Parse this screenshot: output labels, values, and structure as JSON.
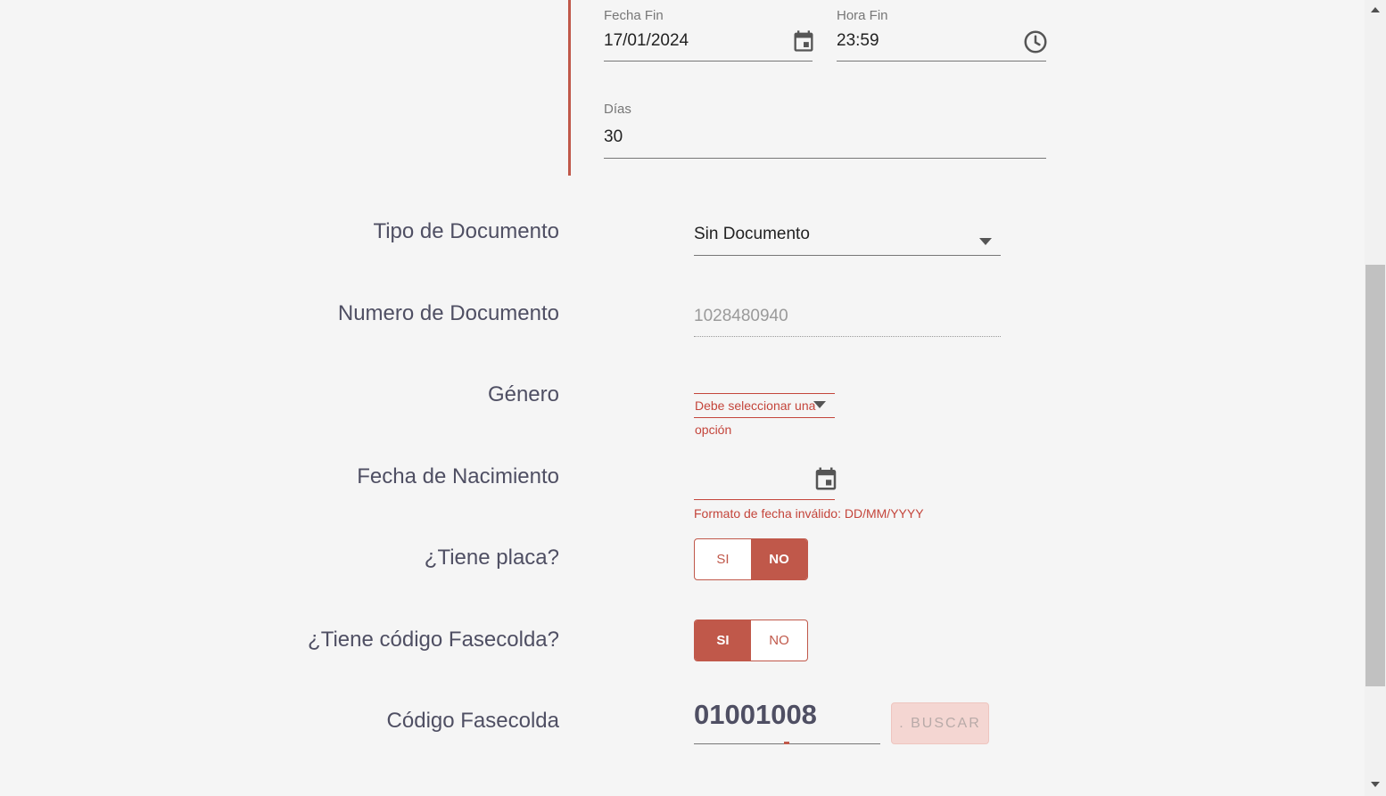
{
  "dates_card": {
    "fecha_fin_label": "Fecha Fin",
    "fecha_fin_value": "17/01/2024",
    "hora_fin_label": "Hora Fin",
    "hora_fin_value": "23:59",
    "dias_label": "Días",
    "dias_value": "30"
  },
  "form": {
    "tipo_documento_label": "Tipo de Documento",
    "tipo_documento_value": "Sin Documento",
    "numero_documento_label": "Numero de Documento",
    "numero_documento_placeholder": "1028480940",
    "genero_label": "Género",
    "genero_error_line1": "Debe seleccionar una",
    "genero_error_line2": "opción",
    "fecha_nacimiento_label": "Fecha de Nacimiento",
    "fecha_nacimiento_error": "Formato de fecha inválido: DD/MM/YYYY",
    "tiene_placa_label": "¿Tiene placa?",
    "tiene_placa_si": "SI",
    "tiene_placa_no": "NO",
    "tiene_fasecolda_label": "¿Tiene código Fasecolda?",
    "tiene_fasecolda_si": "SI",
    "tiene_fasecolda_no": "NO",
    "codigo_fasecolda_label": "Código Fasecolda",
    "codigo_fasecolda_value": "01001008",
    "buscar_label": ". BUSCAR"
  },
  "colors": {
    "accent": "#c0584a",
    "error": "#c4453b",
    "background": "#f5f5f5"
  },
  "icons": {
    "calendar": "calendar-icon",
    "clock": "clock-icon",
    "dropdown": "dropdown-arrow-icon"
  }
}
